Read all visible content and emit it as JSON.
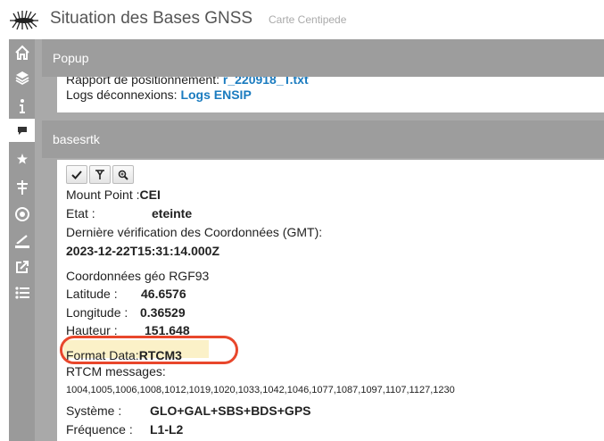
{
  "header": {
    "title": "Situation des Bases GNSS",
    "subtitle": "Carte Centipede",
    "logo_icon": "centipede-logo-icon"
  },
  "sidebar": {
    "items": [
      {
        "name": "home-icon",
        "active": false
      },
      {
        "name": "layers-icon",
        "active": false
      },
      {
        "name": "info-icon",
        "active": false
      },
      {
        "name": "comment-icon",
        "active": true
      },
      {
        "name": "star-icon",
        "active": false
      },
      {
        "name": "antenna-icon",
        "active": false
      },
      {
        "name": "target-icon",
        "active": false
      },
      {
        "name": "measure-icon",
        "active": false
      },
      {
        "name": "share-icon",
        "active": false
      },
      {
        "name": "list-icon",
        "active": false
      }
    ]
  },
  "popup": {
    "heading": "Popup",
    "report_label": "Rapport de positionnement:",
    "report_link": "r_220918_T.txt",
    "logs_label": "Logs déconnexions:",
    "logs_link": "Logs ENSIP"
  },
  "bases": {
    "heading": "basesrtk",
    "toolbar": [
      "check-icon",
      "filter-icon",
      "zoom-icon"
    ],
    "mount_point_label": "Mount Point :",
    "mount_point_value": "CEI",
    "etat_label": "Etat :",
    "etat_value": "eteinte",
    "last_check_label": "Dernière vérification des Coordonnées (GMT):",
    "last_check_value": "2023-12-22T15:31:14.000Z",
    "coords_heading": "Coordonnées géo RGF93",
    "latitude_label": "Latitude :",
    "latitude_value": "46.6576",
    "longitude_label": "Longitude :",
    "longitude_value": "0.36529",
    "hauteur_label": "Hauteur :",
    "hauteur_value": "151.648",
    "format_label": "Format Data:",
    "format_value": "RTCM3",
    "rtcm_label": "RTCM messages:",
    "rtcm_value": "1004,1005,1006,1008,1012,1019,1020,1033,1042,1046,1077,1087,1097,1107,1127,1230",
    "systeme_label": "Système :",
    "systeme_value": "GLO+GAL+SBS+BDS+GPS",
    "frequence_label": "Fréquence :",
    "frequence_value": "L1-L2"
  },
  "colors": {
    "link": "#1a7bbf",
    "panel_header": "#9d9d9d",
    "sidebar": "#9a9a9a",
    "highlight": "#fbf1c8",
    "annotation_ring": "#e8472c"
  }
}
